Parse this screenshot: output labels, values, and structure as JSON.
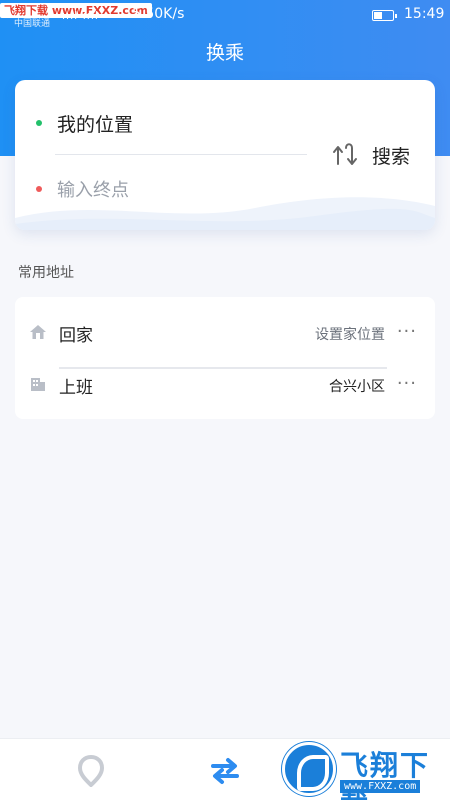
{
  "status_bar": {
    "watermark": "飞翔下载 www.FXXZ.com",
    "carrier": "中国联通",
    "signal": "ıııl ıııl",
    "net_speed": "5.50K/s",
    "time": "15:49",
    "battery_level": 0.4
  },
  "header": {
    "title": "换乘"
  },
  "route": {
    "origin": "我的位置",
    "destination_placeholder": "输入终点",
    "search_label": "搜索",
    "origin_dot_color": "#22c06a",
    "dest_dot_color": "#ef5a5a"
  },
  "frequent": {
    "title": "常用地址",
    "home": {
      "label": "回家",
      "value": "设置家位置",
      "icon": "home-icon"
    },
    "work": {
      "label": "上班",
      "value": "合兴小区",
      "icon": "building-icon"
    },
    "more": "···"
  },
  "bottom_nav": {
    "items": [
      {
        "name": "map",
        "icon": "location-pin-icon",
        "color": "#c8ccd3"
      },
      {
        "name": "transfer",
        "icon": "transfer-icon",
        "color": "#2d8cf0",
        "active": true
      }
    ]
  },
  "watermark_logo": {
    "title": "飞翔下载",
    "url": "www.FXXZ.com"
  },
  "colors": {
    "primary": "#2d8cf0",
    "background": "#f6f7fb"
  }
}
